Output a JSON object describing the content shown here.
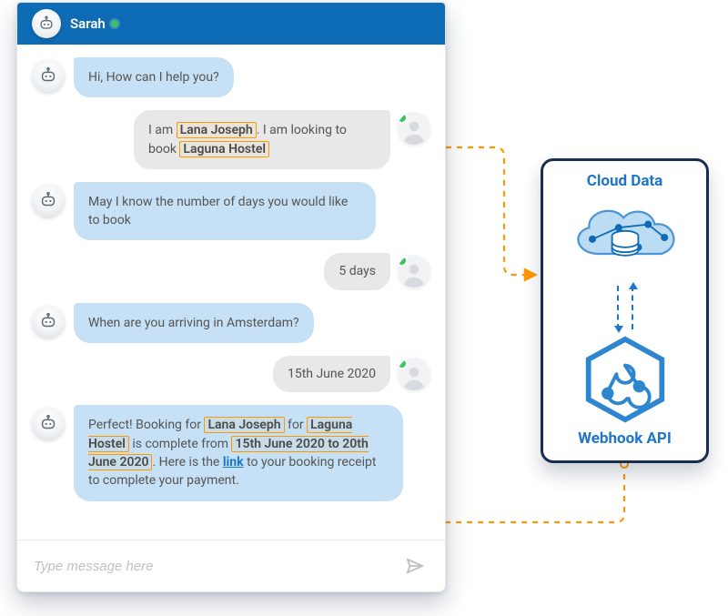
{
  "chat": {
    "header": {
      "name": "Sarah"
    },
    "input_placeholder": "Type message here",
    "messages": {
      "m1": "Hi, How can I help you?",
      "m2_pre": "I am ",
      "m2_hl1": "Lana Joseph",
      "m2_mid": ". I am looking to book ",
      "m2_hl2": "Laguna Hostel",
      "m3": "May I know the number of days you would like to book",
      "m4": "5 days",
      "m5": "When are you arriving in Amsterdam?",
      "m6": "15th June 2020",
      "m7_pre": "Perfect! Booking for ",
      "m7_hl1": "Lana Joseph",
      "m7_mid1": " for ",
      "m7_hl2": "Laguna Hostel",
      "m7_mid2": " is complete from ",
      "m7_hl3": "15th June 2020 to 20th June 2020",
      "m7_mid3": ". Here is the ",
      "m7_link": "link",
      "m7_post": " to your booking receipt to complete your payment."
    }
  },
  "card": {
    "cloud_title": "Cloud Data",
    "webhook_title": "Webhook API"
  },
  "colors": {
    "accent": "#1d76c9",
    "highlight_border": "#ff9800",
    "status_online": "#3bc35f",
    "card_border": "#192d4f"
  }
}
